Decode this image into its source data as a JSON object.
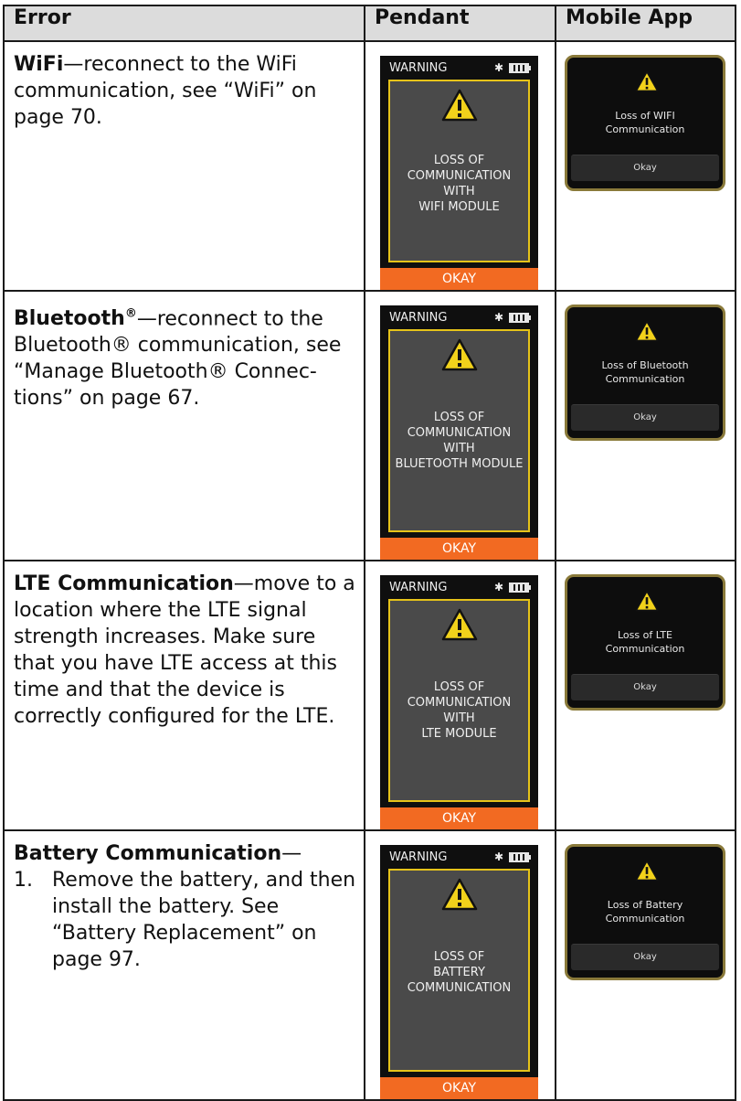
{
  "headers": {
    "error": "Error",
    "pendant": "Pendant",
    "mobile": "Mobile App"
  },
  "colors": {
    "accent_orange": "#f26a22",
    "warning_yellow": "#e6c31a",
    "screen_gray": "#4a4a4a"
  },
  "rows": [
    {
      "title": "WiFi",
      "text": "—reconnect to the WiFi communication, see “WiFi” on page 70.",
      "pendant": {
        "status": "WARNING",
        "line1": "LOSS OF",
        "line2": "COMMUNICATION",
        "line3": "WITH",
        "line4": "WIFI MODULE",
        "button": "OKAY"
      },
      "mobile": {
        "line1": "Loss of WIFI",
        "line2": "Communication",
        "button": "Okay"
      }
    },
    {
      "title": "Bluetooth",
      "reg": "®",
      "text": "—reconnect to the Bluetooth® communication, see “Manage Bluetooth® Connec-tions” on page 67.",
      "pendant": {
        "status": "WARNING",
        "line1": "LOSS OF",
        "line2": "COMMUNICATION",
        "line3": "WITH",
        "line4": "BLUETOOTH MODULE",
        "button": "OKAY"
      },
      "mobile": {
        "line1": "Loss of Bluetooth",
        "line2": "Communication",
        "button": "Okay"
      }
    },
    {
      "title": "LTE Communication",
      "text": "—move to a location where the LTE signal strength increases. Make sure that you have LTE access at this time and that the device is correctly configured for the LTE.",
      "pendant": {
        "status": "WARNING",
        "line1": "LOSS OF",
        "line2": "COMMUNICATION",
        "line3": "WITH",
        "line4": "LTE MODULE",
        "button": "OKAY"
      },
      "mobile": {
        "line1": "Loss of LTE",
        "line2": "Communication",
        "button": "Okay"
      }
    },
    {
      "title": "Battery Communication",
      "text": "—",
      "step_num": "1.",
      "step_text": "Remove the battery, and then install the battery. See “Battery Replacement” on page 97.",
      "pendant": {
        "status": "WARNING",
        "line1": "LOSS OF",
        "line2": "BATTERY",
        "line3": "COMMUNICATION",
        "line4": "",
        "button": "OKAY"
      },
      "mobile": {
        "line1": "Loss of Battery",
        "line2": "Communication",
        "button": "Okay"
      }
    }
  ]
}
